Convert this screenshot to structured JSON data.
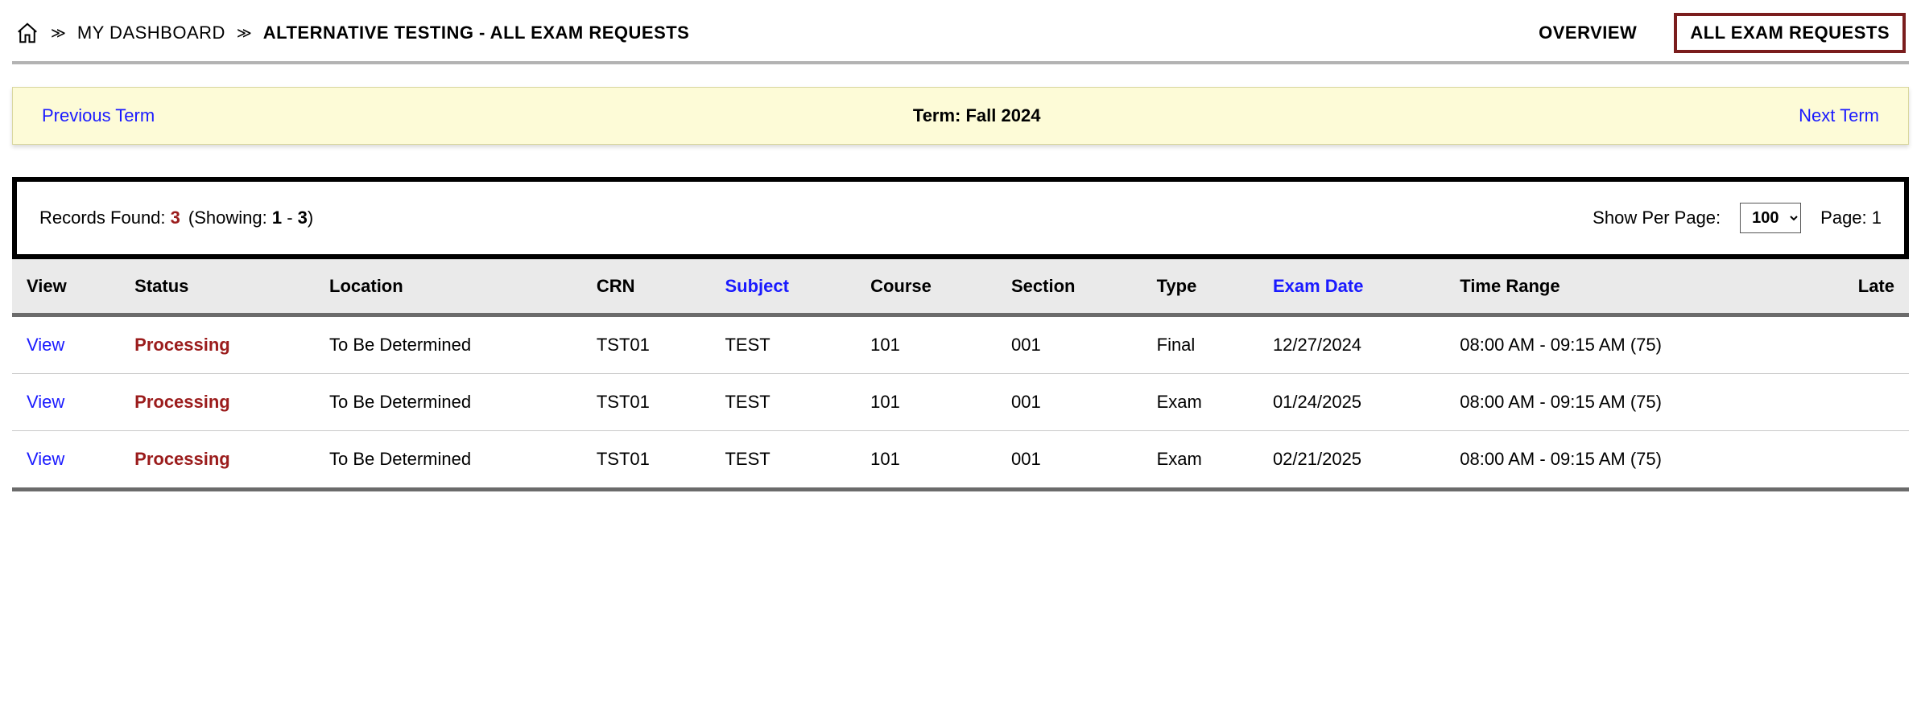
{
  "breadcrumb": {
    "dashboard": "MY DASHBOARD",
    "current": "ALTERNATIVE TESTING - ALL EXAM REQUESTS"
  },
  "tabs": {
    "overview": "OVERVIEW",
    "all_requests": "ALL EXAM REQUESTS"
  },
  "term_nav": {
    "prev": "Previous Term",
    "title": "Term: Fall 2024",
    "next": "Next Term"
  },
  "records": {
    "label_prefix": "Records Found: ",
    "count": "3",
    "showing_prefix": "(Showing: ",
    "from": "1",
    "dash": " - ",
    "to": "3",
    "showing_suffix": ")",
    "per_page_label": "Show Per Page:",
    "per_page_value": "100",
    "page_label": "Page: 1"
  },
  "headers": {
    "view": "View",
    "status": "Status",
    "location": "Location",
    "crn": "CRN",
    "subject": "Subject",
    "course": "Course",
    "section": "Section",
    "type": "Type",
    "exam_date": "Exam Date",
    "time_range": "Time Range",
    "late": "Late"
  },
  "rows": [
    {
      "view": "View",
      "status": "Processing",
      "location": "To Be Determined",
      "crn": "TST01",
      "subject": "TEST",
      "course": "101",
      "section": "001",
      "type": "Final",
      "exam_date": "12/27/2024",
      "time_range": "08:00 AM - 09:15 AM (75)",
      "late": ""
    },
    {
      "view": "View",
      "status": "Processing",
      "location": "To Be Determined",
      "crn": "TST01",
      "subject": "TEST",
      "course": "101",
      "section": "001",
      "type": "Exam",
      "exam_date": "01/24/2025",
      "time_range": "08:00 AM - 09:15 AM (75)",
      "late": ""
    },
    {
      "view": "View",
      "status": "Processing",
      "location": "To Be Determined",
      "crn": "TST01",
      "subject": "TEST",
      "course": "101",
      "section": "001",
      "type": "Exam",
      "exam_date": "02/21/2025",
      "time_range": "08:00 AM - 09:15 AM (75)",
      "late": ""
    }
  ]
}
